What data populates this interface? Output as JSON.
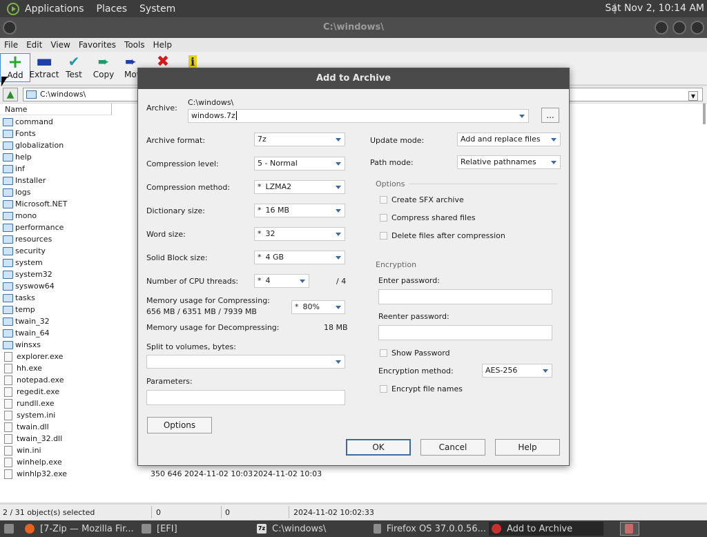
{
  "top_panel": {
    "menus": [
      "Applications",
      "Places",
      "System"
    ],
    "clock": "Sat Nov  2, 10:14 AM"
  },
  "window": {
    "title": "C:\\windows\\",
    "menu": [
      "File",
      "Edit",
      "View",
      "Favorites",
      "Tools",
      "Help"
    ],
    "toolbar": {
      "add": "Add",
      "extract": "Extract",
      "test": "Test",
      "copy": "Copy",
      "move": "Move"
    },
    "address": "C:\\windows\\",
    "column_name": "Name",
    "folders": [
      "command",
      "Fonts",
      "globalization",
      "help",
      "inf",
      "Installer",
      "logs",
      "Microsoft.NET",
      "mono",
      "performance",
      "resources",
      "security",
      "system",
      "system32",
      "syswow64",
      "tasks",
      "temp",
      "twain_32",
      "twain_64",
      "winsxs"
    ],
    "files": [
      "explorer.exe",
      "hh.exe",
      "notepad.exe",
      "regedit.exe",
      "rundll.exe",
      "system.ini",
      "twain.dll",
      "twain_32.dll",
      "win.ini",
      "winhelp.exe",
      "winhlp32.exe"
    ],
    "last_row_meta": {
      "size": "350 646",
      "modified": "2024-11-02 10:03",
      "created": "2024-11-02 10:03"
    },
    "status": {
      "selected": "2 / 31 object(s) selected",
      "size1": "0",
      "size2": "0",
      "time": "2024-11-02 10:02:33"
    }
  },
  "dialog": {
    "title": "Add to Archive",
    "archive_label": "Archive:",
    "archive_path": "C:\\windows\\",
    "archive_name": "windows.7z",
    "browse": "...",
    "format_label": "Archive format:",
    "format_value": "7z",
    "level_label": "Compression level:",
    "level_value": "5 - Normal",
    "method_label": "Compression method:",
    "method_value": "LZMA2",
    "dict_label": "Dictionary size:",
    "dict_value": "16 MB",
    "word_label": "Word size:",
    "word_value": "32",
    "solid_label": "Solid Block size:",
    "solid_value": "4 GB",
    "threads_label": "Number of CPU threads:",
    "threads_value": "4",
    "threads_max": "/ 4",
    "mem_comp_label": "Memory usage for Compressing:",
    "mem_comp_value": "656 MB / 6351 MB / 7939 MB",
    "mem_percent": "80%",
    "mem_decomp_label": "Memory usage for Decompressing:",
    "mem_decomp_value": "18 MB",
    "split_label": "Split to volumes, bytes:",
    "params_label": "Parameters:",
    "options_button": "Options",
    "update_label": "Update mode:",
    "update_value": "Add and replace files",
    "path_label": "Path mode:",
    "path_value": "Relative pathnames",
    "options_group": "Options",
    "opt_sfx": "Create SFX archive",
    "opt_shared": "Compress shared files",
    "opt_delete": "Delete files after compression",
    "encryption_group": "Encryption",
    "enter_pw_label": "Enter password:",
    "reenter_pw_label": "Reenter password:",
    "show_pw": "Show Password",
    "enc_method_label": "Encryption method:",
    "enc_method_value": "AES-256",
    "encrypt_names": "Encrypt file names",
    "ok": "OK",
    "cancel": "Cancel",
    "help": "Help"
  },
  "taskbar": {
    "tasks": [
      "[7-Zip — Mozilla Fir...",
      "[EFI]",
      "C:\\windows\\",
      "Firefox OS 37.0.0.56...",
      "Add to Archive"
    ]
  }
}
